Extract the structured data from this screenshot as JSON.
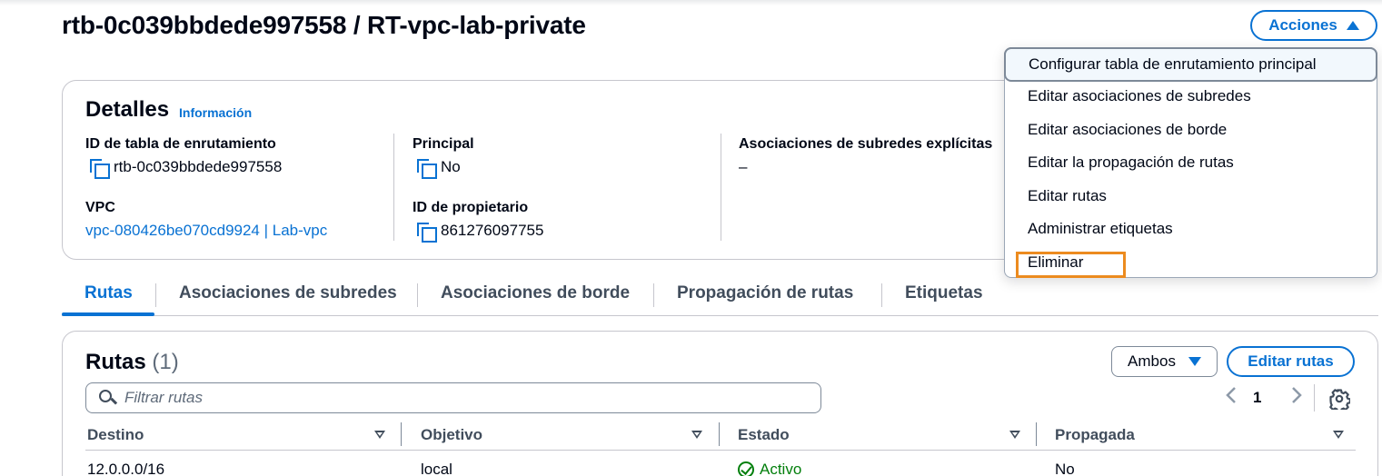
{
  "header": {
    "title": "rtb-0c039bbdede997558 / RT-vpc-lab-private",
    "actions_label": "Acciones",
    "actions_icon": "caret-up-icon"
  },
  "actions_menu": {
    "items": [
      {
        "label": "Configurar tabla de enrutamiento principal",
        "state": "hovered"
      },
      {
        "label": "Editar asociaciones de subredes"
      },
      {
        "label": "Editar asociaciones de borde"
      },
      {
        "label": "Editar la propagación de rutas"
      },
      {
        "label": "Editar rutas"
      },
      {
        "label": "Administrar etiquetas"
      },
      {
        "label": "Eliminar",
        "state": "highlighted-box"
      }
    ],
    "highlight_color": "#ec8b1f"
  },
  "details": {
    "title": "Detalles",
    "info_link": "Información",
    "route_table_id_label": "ID de tabla de enrutamiento",
    "route_table_id": "rtb-0c039bbdede997558",
    "vpc_label": "VPC",
    "vpc_value": "vpc-080426be070cd9924 | Lab-vpc",
    "main_label": "Principal",
    "main_value": "No",
    "owner_label": "ID de propietario",
    "owner_value": "861276097755",
    "explicit_assoc_label": "Asociaciones de subredes explícitas",
    "explicit_assoc_value": "–"
  },
  "tabs": [
    {
      "label": "Rutas",
      "active": true
    },
    {
      "label": "Asociaciones de subredes"
    },
    {
      "label": "Asociaciones de borde"
    },
    {
      "label": "Propagación de rutas"
    },
    {
      "label": "Etiquetas"
    }
  ],
  "routes": {
    "title": "Rutas",
    "count": "(1)",
    "filter_select": "Ambos",
    "edit_label": "Editar rutas",
    "filter_placeholder": "Filtrar rutas",
    "prev_icon": "chevron-left-icon",
    "page": "1",
    "next_icon": "chevron-right-icon",
    "settings_icon": "gear-icon",
    "columns": [
      "Destino",
      "Objetivo",
      "Estado",
      "Propagada"
    ],
    "rows": [
      {
        "destino": "12.0.0.0/16",
        "objetivo": "local",
        "estado": "Activo",
        "propagada": "No"
      }
    ]
  },
  "colors": {
    "link": "#0972d3",
    "success": "#037f0c",
    "text": "#000716"
  }
}
